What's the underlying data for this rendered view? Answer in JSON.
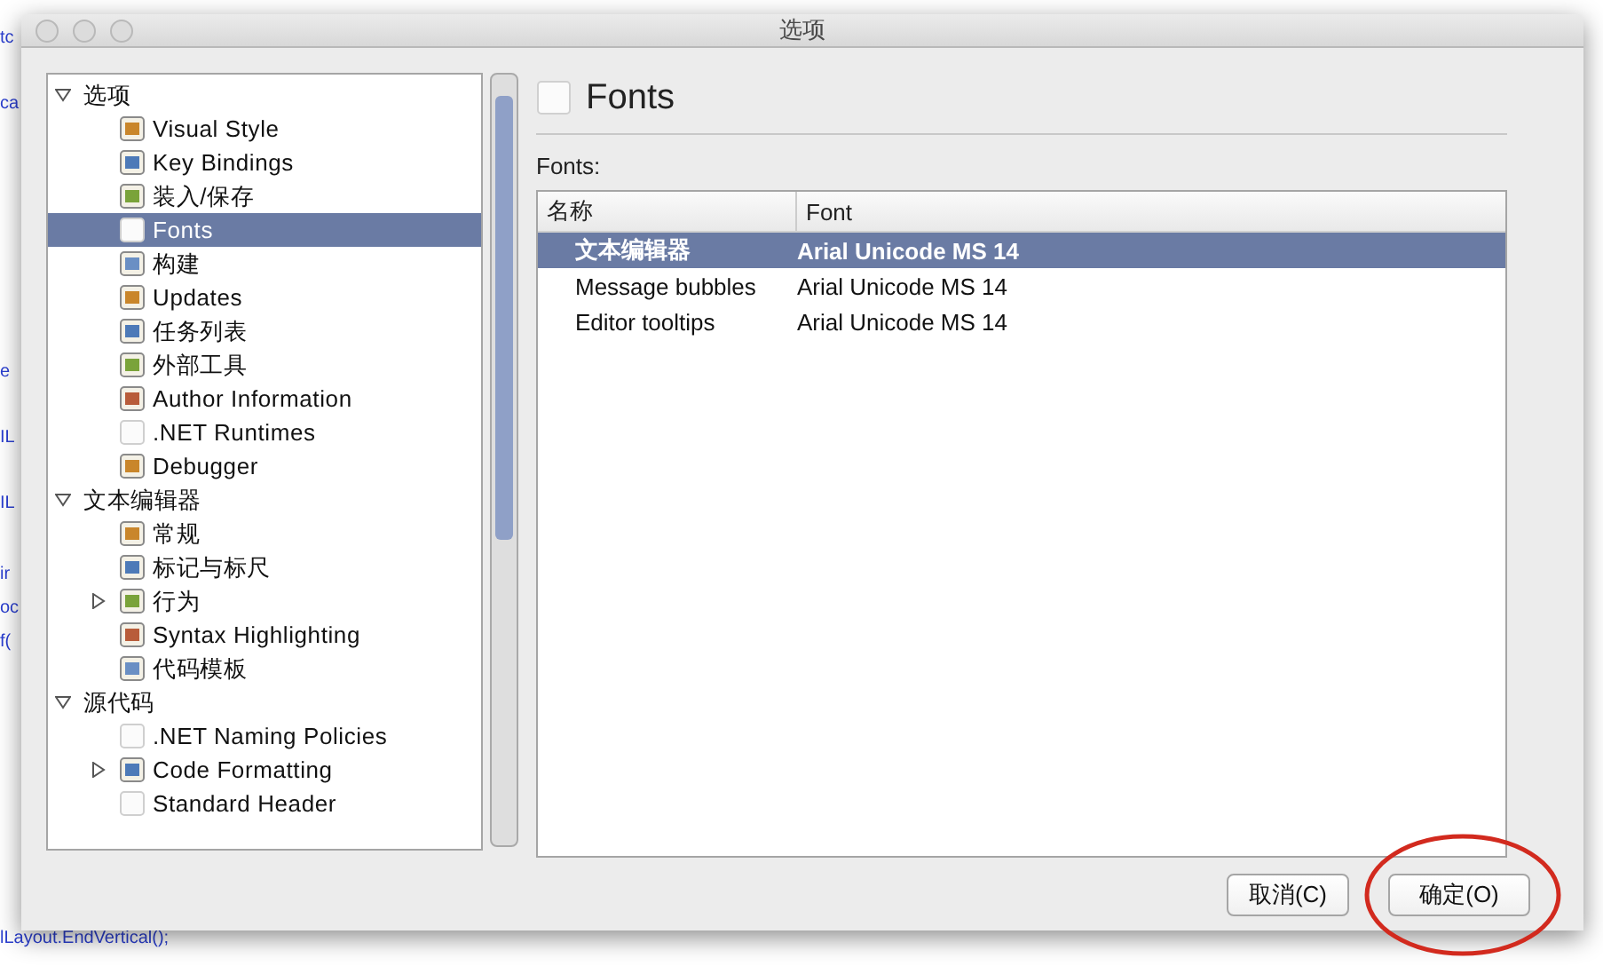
{
  "background_editor": {
    "lines": [
      {
        "text": "tc"
      },
      {
        "text": "ca"
      },
      {
        "text": "e"
      },
      {
        "text": "IL"
      },
      {
        "text": "IL"
      },
      {
        "text": "ir"
      },
      {
        "text": "oc"
      },
      {
        "text": "f("
      },
      {
        "text": "lLayout.EndVertical();"
      }
    ]
  },
  "window": {
    "title": "选项"
  },
  "tree": [
    {
      "label": "选项",
      "expanded": true,
      "selected": false,
      "children": [
        {
          "label": "Visual Style",
          "kind": "tool",
          "selected": false
        },
        {
          "label": "Key Bindings",
          "kind": "tool",
          "selected": false
        },
        {
          "label": "装入/保存",
          "kind": "tool",
          "selected": false
        },
        {
          "label": "Fonts",
          "kind": "blank",
          "selected": true
        },
        {
          "label": "构建",
          "kind": "tool",
          "selected": false
        },
        {
          "label": "Updates",
          "kind": "tool",
          "selected": false
        },
        {
          "label": "任务列表",
          "kind": "tool",
          "selected": false
        },
        {
          "label": "外部工具",
          "kind": "tool",
          "selected": false
        },
        {
          "label": "Author Information",
          "kind": "tool",
          "selected": false
        },
        {
          "label": ".NET Runtimes",
          "kind": "blank",
          "selected": false
        },
        {
          "label": "Debugger",
          "kind": "tool",
          "selected": false
        }
      ]
    },
    {
      "label": "文本编辑器",
      "expanded": true,
      "selected": false,
      "children": [
        {
          "label": "常规",
          "kind": "tool",
          "selected": false
        },
        {
          "label": "标记与标尺",
          "kind": "tool",
          "selected": false
        },
        {
          "label": "行为",
          "kind": "tool",
          "selected": false,
          "expanded": false
        },
        {
          "label": "Syntax Highlighting",
          "kind": "tool",
          "selected": false
        },
        {
          "label": "代码模板",
          "kind": "tool",
          "selected": false
        }
      ]
    },
    {
      "label": "源代码",
      "expanded": true,
      "selected": false,
      "children": [
        {
          "label": ".NET Naming Policies",
          "kind": "blank",
          "selected": false
        },
        {
          "label": "Code Formatting",
          "kind": "tool",
          "selected": false,
          "expanded": false
        },
        {
          "label": "Standard Header",
          "kind": "blank",
          "selected": false
        }
      ]
    }
  ],
  "panel": {
    "title": "Fonts",
    "list_label": "Fonts:",
    "table": {
      "columns": [
        "名称",
        "Font"
      ],
      "rows": [
        {
          "name": "文本编辑器",
          "font": "Arial Unicode MS 14",
          "selected": true
        },
        {
          "name": "Message bubbles",
          "font": "Arial Unicode MS 14",
          "selected": false
        },
        {
          "name": "Editor tooltips",
          "font": "Arial Unicode MS 14",
          "selected": false
        }
      ]
    }
  },
  "buttons": [
    {
      "label": "取消(C)",
      "circled": false
    },
    {
      "label": "确定(O)",
      "circled": true
    }
  ]
}
